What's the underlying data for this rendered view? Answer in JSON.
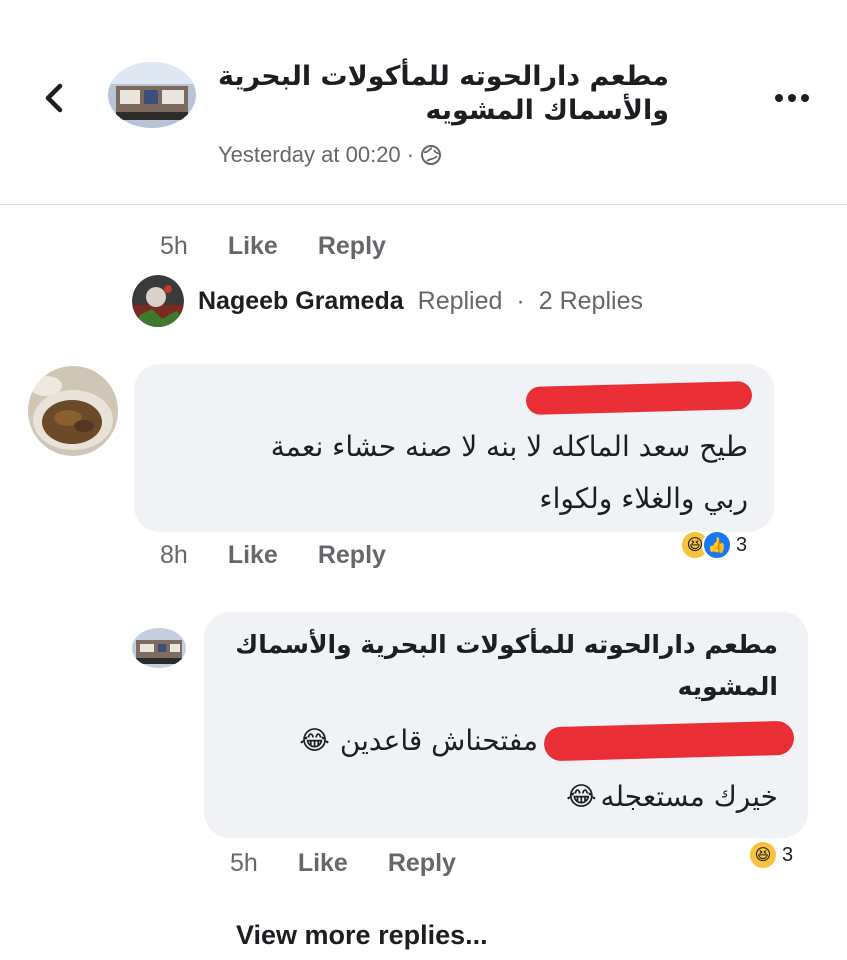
{
  "header": {
    "page_name": "مطعم دارالحوته للمأكولات البحرية والأسماك المشويه",
    "timestamp": "Yesterday at 00:20 ·",
    "privacy_icon": "globe-icon",
    "back_icon": "chevron-left-icon",
    "more_icon": "more-dots-icon"
  },
  "top_comment": {
    "time": "5h",
    "like_label": "Like",
    "reply_label": "Reply"
  },
  "replied_row": {
    "name": "Nageeb Grameda",
    "replied_label": "Replied",
    "separator": "·",
    "replies_label": "2 Replies"
  },
  "comment1": {
    "text_line1": "طيح سعد الماكله لا بنه لا صنه حشاء نعمة",
    "text_line2": "ربي والغلاء ولكواء",
    "time": "8h",
    "like_label": "Like",
    "reply_label": "Reply",
    "reaction_count": "3"
  },
  "comment2": {
    "author_line1": "مطعم دارالحوته للمأكولات البحرية والأسماك",
    "author_line2": "المشويه",
    "text_line1": "مفتحناش قاعدين",
    "text_line2": "خيرك مستعجله",
    "time": "5h",
    "like_label": "Like",
    "reply_label": "Reply",
    "reaction_count": "3"
  },
  "view_more": "View more replies...",
  "colors": {
    "bubble": "#f0f2f5",
    "meta_text": "#65676b",
    "redaction": "#e8232b",
    "like_blue": "#1877f2"
  }
}
